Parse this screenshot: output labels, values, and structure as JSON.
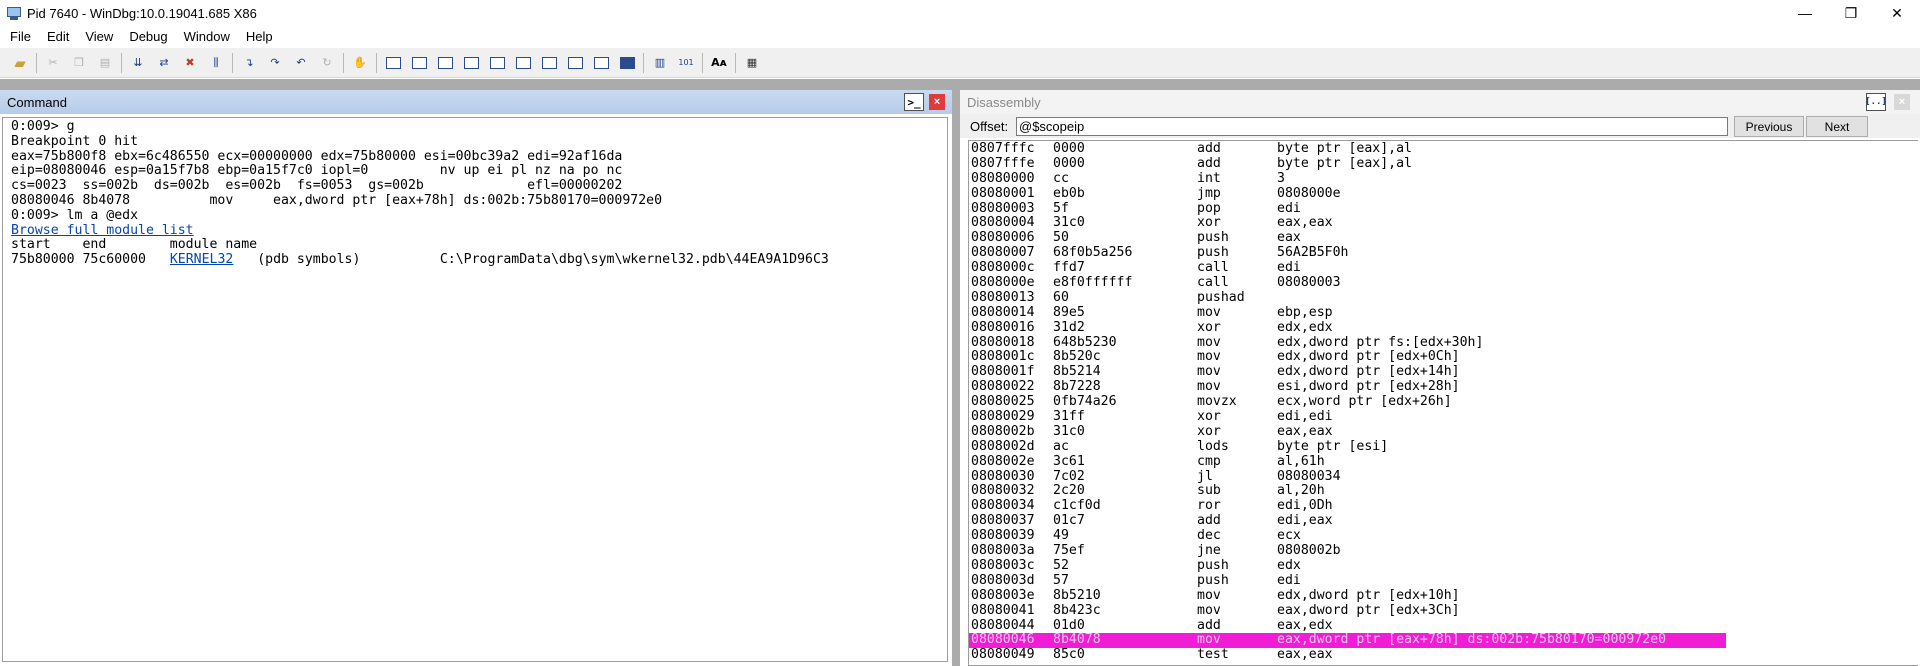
{
  "window": {
    "title": "Pid 7640 - WinDbg:10.0.19041.685 X86",
    "controls": {
      "minimize": "—",
      "maximize": "❐",
      "close": "✕"
    }
  },
  "menu": [
    "File",
    "Edit",
    "View",
    "Debug",
    "Window",
    "Help"
  ],
  "command_pane": {
    "title": "Command",
    "icon_glyph": ">_",
    "close_glyph": "×",
    "lines": [
      "0:009> g",
      "Breakpoint 0 hit",
      "eax=75b800f8 ebx=6c486550 ecx=00000000 edx=75b80000 esi=00bc39a2 edi=92af16da",
      "eip=08080046 esp=0a15f7b8 ebp=0a15f7c0 iopl=0         nv up ei pl nz na po nc",
      "cs=0023  ss=002b  ds=002b  es=002b  fs=0053  gs=002b             efl=00000202",
      "08080046 8b4078          mov     eax,dword ptr [eax+78h] ds:002b:75b80170=000972e0",
      "0:009> lm a @edx"
    ],
    "browse_link": "Browse full module list",
    "module_header": "start    end        module name",
    "module_row": {
      "start": "75b80000",
      "end": "75c60000",
      "name": "KERNEL32",
      "symbols": "(pdb symbols)",
      "path": "C:\\ProgramData\\dbg\\sym\\wkernel32.pdb\\44EA9A1D96C3"
    }
  },
  "disassembly_pane": {
    "title": "Disassembly",
    "offset_label": "Offset:",
    "offset_value": "@$scopeip",
    "previous_label": "Previous",
    "next_label": "Next",
    "highlight_color": "#f01cd6",
    "rows": [
      {
        "addr": "0807fffc",
        "bytes": "0000",
        "mn": "add",
        "op": "byte ptr [eax],al"
      },
      {
        "addr": "0807fffe",
        "bytes": "0000",
        "mn": "add",
        "op": "byte ptr [eax],al"
      },
      {
        "addr": "08080000",
        "bytes": "cc",
        "mn": "int",
        "op": "3"
      },
      {
        "addr": "08080001",
        "bytes": "eb0b",
        "mn": "jmp",
        "op": "0808000e"
      },
      {
        "addr": "08080003",
        "bytes": "5f",
        "mn": "pop",
        "op": "edi"
      },
      {
        "addr": "08080004",
        "bytes": "31c0",
        "mn": "xor",
        "op": "eax,eax"
      },
      {
        "addr": "08080006",
        "bytes": "50",
        "mn": "push",
        "op": "eax"
      },
      {
        "addr": "08080007",
        "bytes": "68f0b5a256",
        "mn": "push",
        "op": "56A2B5F0h"
      },
      {
        "addr": "0808000c",
        "bytes": "ffd7",
        "mn": "call",
        "op": "edi"
      },
      {
        "addr": "0808000e",
        "bytes": "e8f0ffffff",
        "mn": "call",
        "op": "08080003"
      },
      {
        "addr": "08080013",
        "bytes": "60",
        "mn": "pushad",
        "op": ""
      },
      {
        "addr": "08080014",
        "bytes": "89e5",
        "mn": "mov",
        "op": "ebp,esp"
      },
      {
        "addr": "08080016",
        "bytes": "31d2",
        "mn": "xor",
        "op": "edx,edx"
      },
      {
        "addr": "08080018",
        "bytes": "648b5230",
        "mn": "mov",
        "op": "edx,dword ptr fs:[edx+30h]"
      },
      {
        "addr": "0808001c",
        "bytes": "8b520c",
        "mn": "mov",
        "op": "edx,dword ptr [edx+0Ch]"
      },
      {
        "addr": "0808001f",
        "bytes": "8b5214",
        "mn": "mov",
        "op": "edx,dword ptr [edx+14h]"
      },
      {
        "addr": "08080022",
        "bytes": "8b7228",
        "mn": "mov",
        "op": "esi,dword ptr [edx+28h]"
      },
      {
        "addr": "08080025",
        "bytes": "0fb74a26",
        "mn": "movzx",
        "op": "ecx,word ptr [edx+26h]"
      },
      {
        "addr": "08080029",
        "bytes": "31ff",
        "mn": "xor",
        "op": "edi,edi"
      },
      {
        "addr": "0808002b",
        "bytes": "31c0",
        "mn": "xor",
        "op": "eax,eax"
      },
      {
        "addr": "0808002d",
        "bytes": "ac",
        "mn": "lods",
        "op": "byte ptr [esi]"
      },
      {
        "addr": "0808002e",
        "bytes": "3c61",
        "mn": "cmp",
        "op": "al,61h"
      },
      {
        "addr": "08080030",
        "bytes": "7c02",
        "mn": "jl",
        "op": "08080034"
      },
      {
        "addr": "08080032",
        "bytes": "2c20",
        "mn": "sub",
        "op": "al,20h"
      },
      {
        "addr": "08080034",
        "bytes": "c1cf0d",
        "mn": "ror",
        "op": "edi,0Dh"
      },
      {
        "addr": "08080037",
        "bytes": "01c7",
        "mn": "add",
        "op": "edi,eax"
      },
      {
        "addr": "08080039",
        "bytes": "49",
        "mn": "dec",
        "op": "ecx"
      },
      {
        "addr": "0808003a",
        "bytes": "75ef",
        "mn": "jne",
        "op": "0808002b"
      },
      {
        "addr": "0808003c",
        "bytes": "52",
        "mn": "push",
        "op": "edx"
      },
      {
        "addr": "0808003d",
        "bytes": "57",
        "mn": "push",
        "op": "edi"
      },
      {
        "addr": "0808003e",
        "bytes": "8b5210",
        "mn": "mov",
        "op": "edx,dword ptr [edx+10h]"
      },
      {
        "addr": "08080041",
        "bytes": "8b423c",
        "mn": "mov",
        "op": "eax,dword ptr [edx+3Ch]"
      },
      {
        "addr": "08080044",
        "bytes": "01d0",
        "mn": "add",
        "op": "eax,edx"
      },
      {
        "addr": "08080046",
        "bytes": "8b4078",
        "mn": "mov",
        "op": "eax,dword ptr [eax+78h] ds:002b:75b80170=000972e0",
        "current": true
      },
      {
        "addr": "08080049",
        "bytes": "85c0",
        "mn": "test",
        "op": "eax,eax"
      }
    ]
  }
}
